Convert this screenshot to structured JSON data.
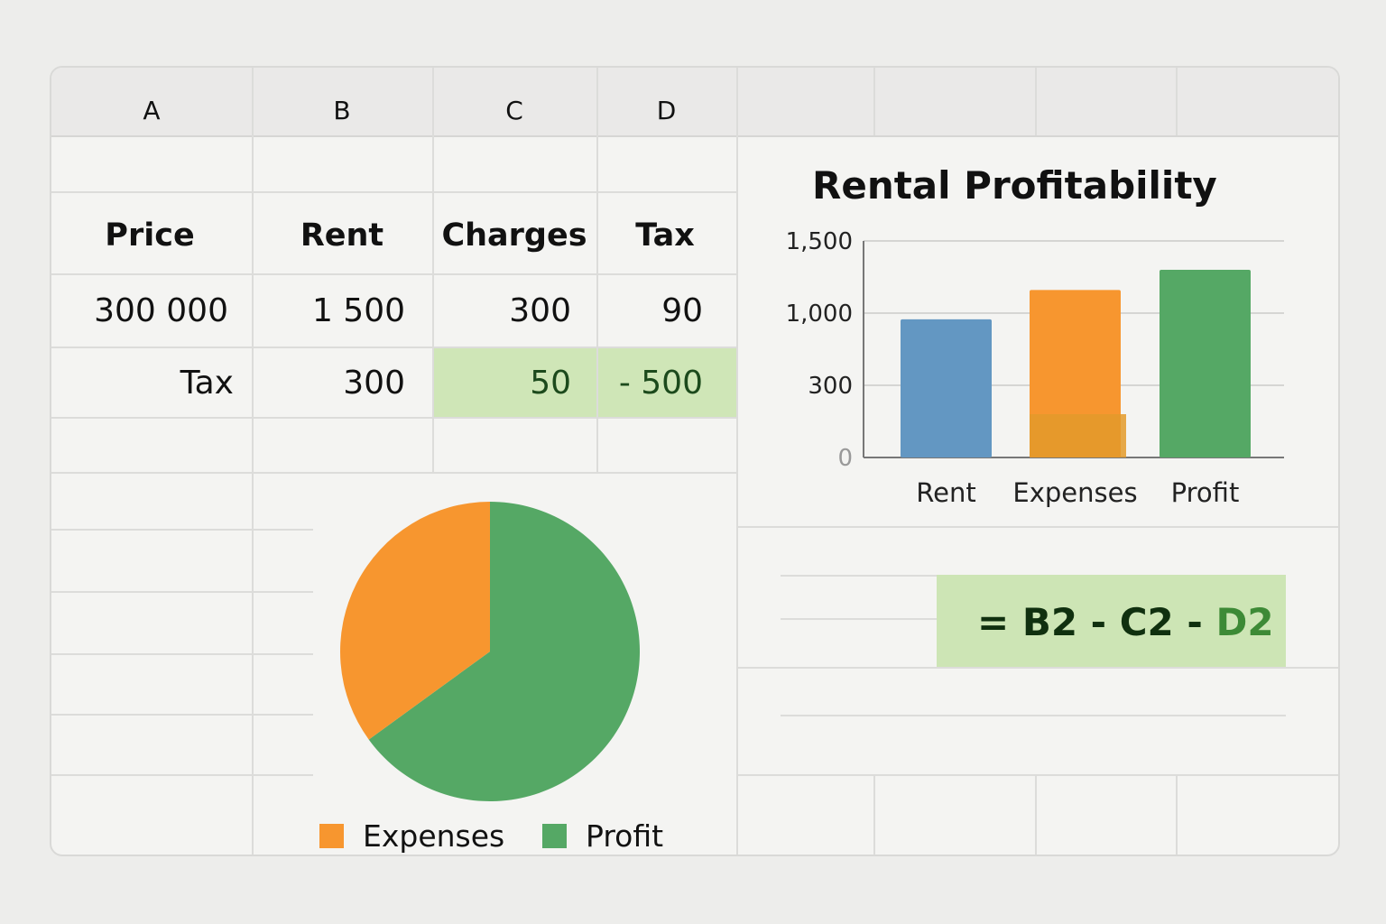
{
  "columns": [
    "A",
    "B",
    "C",
    "D"
  ],
  "table": {
    "headers": [
      "Price",
      "Rent",
      "Charges",
      "Tax"
    ],
    "row1": [
      "300 000",
      "1 500",
      "300",
      "90"
    ],
    "row2": [
      "Tax",
      "300",
      "50",
      "- 500"
    ]
  },
  "formula": {
    "prefix": "= B2 - C2 - ",
    "highlight": "D2"
  },
  "colors": {
    "rent": "#6397c2",
    "expenses": "#f7962f",
    "profit": "#55a865",
    "highlight": "#cfe6b7"
  },
  "chart_data": [
    {
      "type": "bar",
      "title": "Rental Profitability",
      "categories": [
        "Rent",
        "Expenses",
        "Profit"
      ],
      "values": [
        940,
        1160,
        1300
      ],
      "stacked_segment": {
        "category": "Expenses",
        "value": 300
      },
      "yticks": [
        "0",
        "300",
        "1,000",
        "1,500"
      ],
      "ylim": [
        0,
        1500
      ],
      "grid": true,
      "series": [
        {
          "values": [
            940,
            1160,
            1300
          ]
        }
      ]
    },
    {
      "type": "pie",
      "labels": [
        "Expenses",
        "Profit"
      ],
      "values": [
        35,
        65
      ],
      "legend": "bottom"
    }
  ]
}
